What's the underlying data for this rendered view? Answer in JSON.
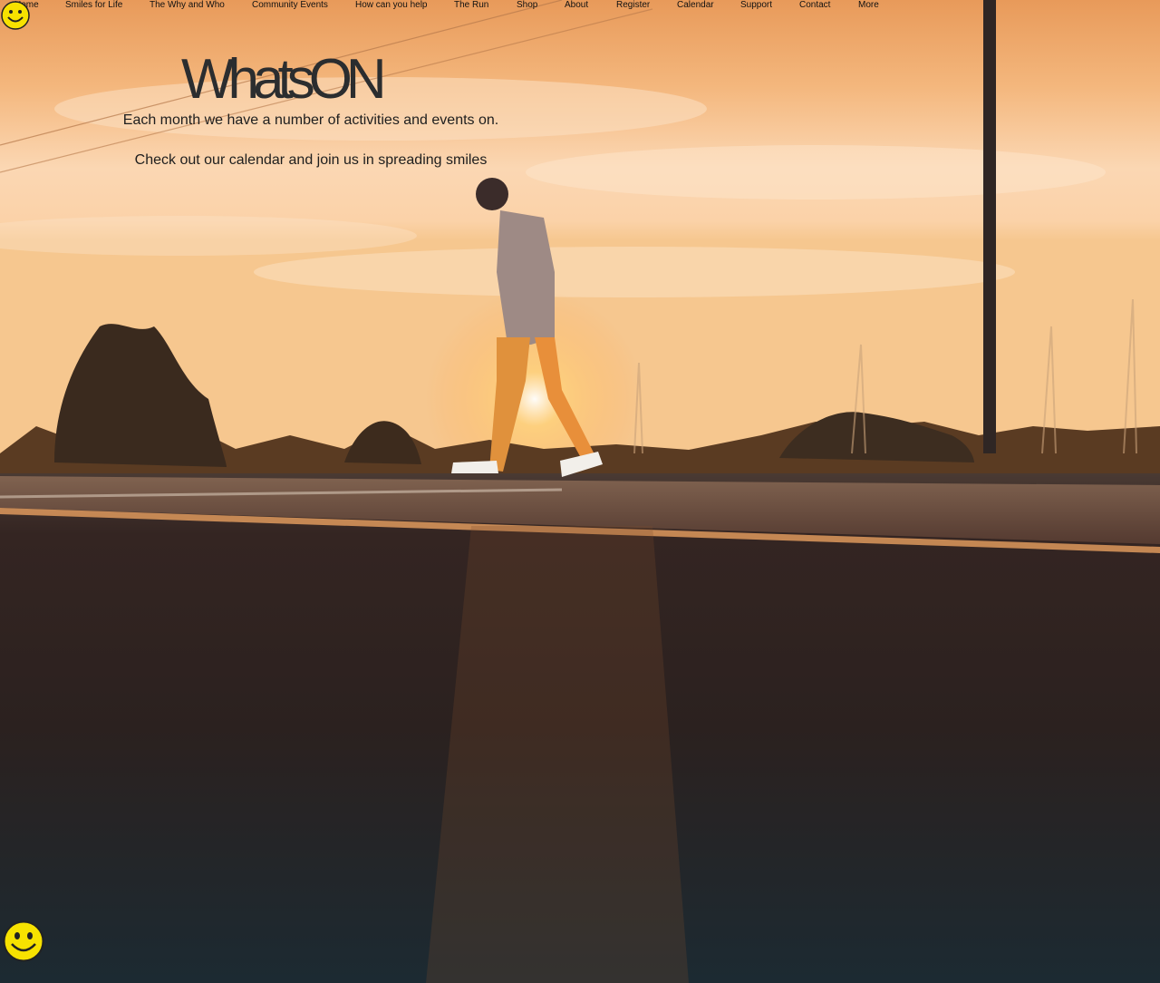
{
  "nav": {
    "items": [
      "Home",
      "Smiles for Life",
      "The Why and Who",
      "Community Events",
      "How can you help",
      "The Run",
      "Shop",
      "About",
      "Register",
      "Calendar",
      "Support",
      "Contact",
      "More"
    ]
  },
  "hero": {
    "title": "WhatsON",
    "line1": "Each month we have a number of activities and events on.",
    "line2": "Check out our calendar and join us in spreading smiles"
  },
  "icons": {
    "logo": "smiley-icon",
    "chat": "smiley-icon"
  },
  "colors": {
    "sky_top": "#f0a865",
    "sky_mid": "#f9d4ab",
    "road": "#2a2a2c",
    "smiley": "#f7e200"
  }
}
